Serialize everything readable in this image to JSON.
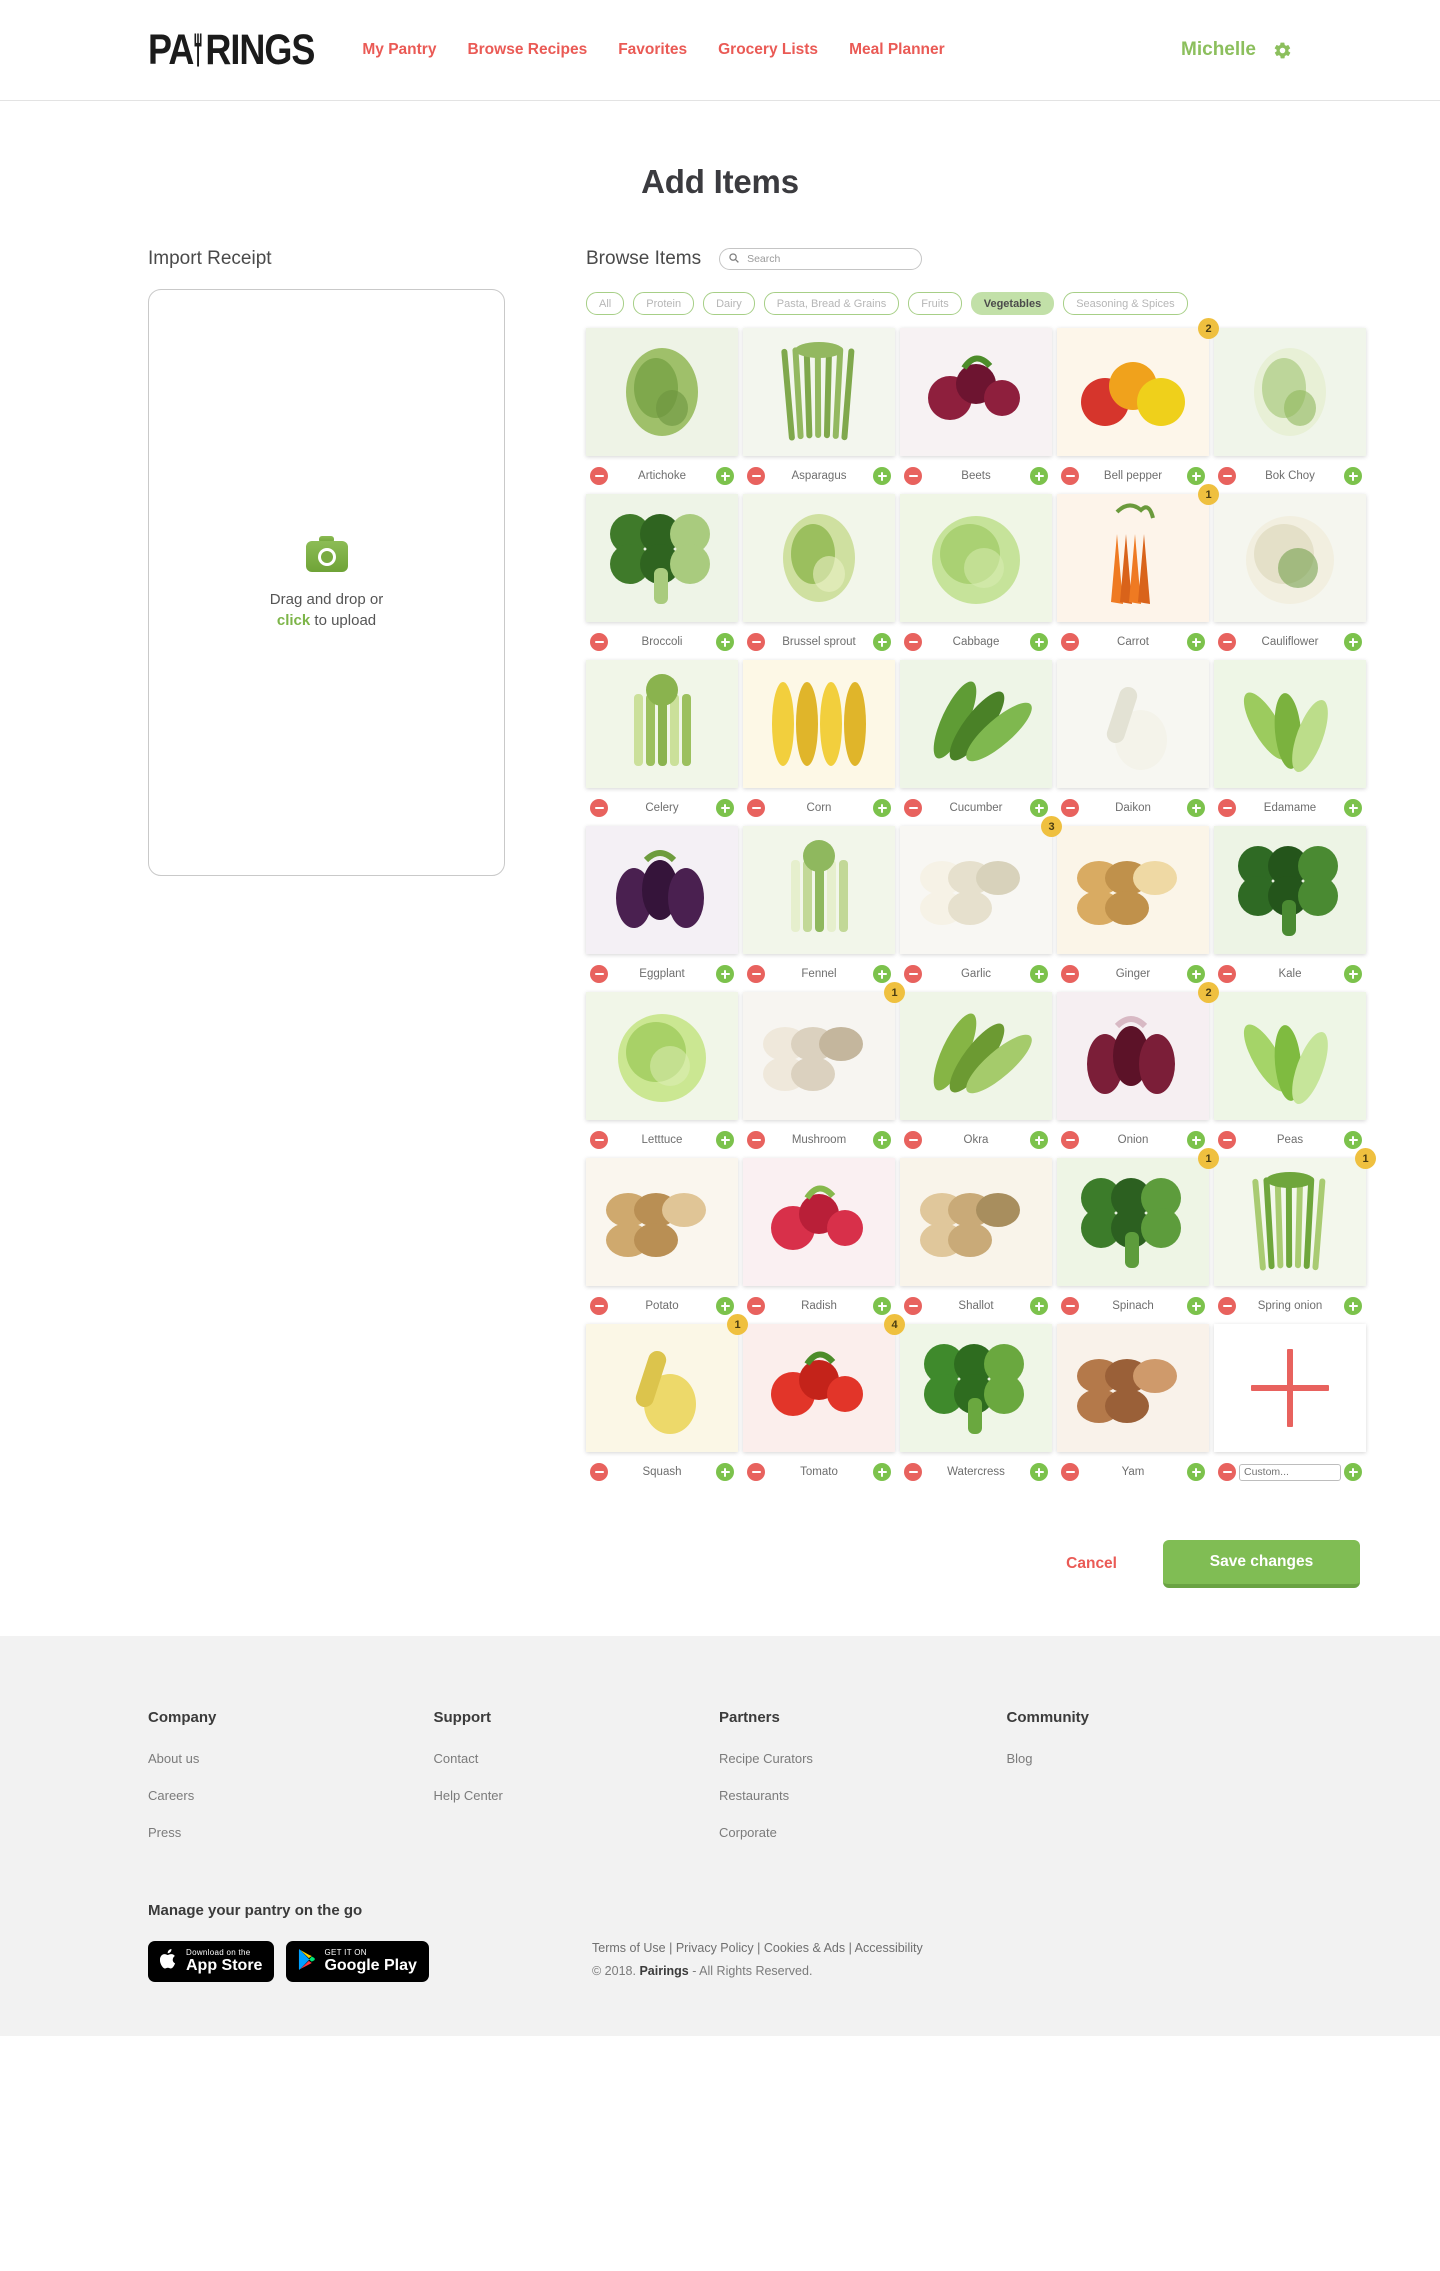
{
  "header": {
    "logo_text_a": "PA",
    "logo_text_b": "RINGS",
    "nav": [
      {
        "label": "My Pantry"
      },
      {
        "label": "Browse Recipes"
      },
      {
        "label": "Favorites"
      },
      {
        "label": "Grocery Lists"
      },
      {
        "label": "Meal Planner"
      }
    ],
    "user_name": "Michelle",
    "settings_icon": "gear-icon",
    "accent_red": "#ea5a55",
    "accent_green": "#8cbf5d"
  },
  "page_title": "Add Items",
  "import": {
    "title": "Import Receipt",
    "icon": "camera-icon",
    "line1": "Drag and drop or",
    "line2_link": "click",
    "line2_rest": " to upload"
  },
  "browse": {
    "title": "Browse Items",
    "search_placeholder": "Search",
    "search_value": "",
    "search_icon": "search-icon",
    "filters": [
      {
        "label": "All",
        "active": false
      },
      {
        "label": "Protein",
        "active": false
      },
      {
        "label": "Dairy",
        "active": false
      },
      {
        "label": "Pasta, Bread & Grains",
        "active": false
      },
      {
        "label": "Fruits",
        "active": false
      },
      {
        "label": "Vegetables",
        "active": true
      },
      {
        "label": "Seasoning & Spices",
        "active": false
      }
    ],
    "items": [
      {
        "name": "Artichoke",
        "badge": null,
        "img": "artichoke"
      },
      {
        "name": "Asparagus",
        "badge": null,
        "img": "asparagus"
      },
      {
        "name": "Beets",
        "badge": null,
        "img": "beets"
      },
      {
        "name": "Bell pepper",
        "badge": "2",
        "img": "bellpepper"
      },
      {
        "name": "Bok Choy",
        "badge": null,
        "img": "bokchoy"
      },
      {
        "name": "Broccoli",
        "badge": null,
        "img": "broccoli"
      },
      {
        "name": "Brussel sprout",
        "badge": null,
        "img": "brussel"
      },
      {
        "name": "Cabbage",
        "badge": null,
        "img": "cabbage"
      },
      {
        "name": "Carrot",
        "badge": "1",
        "img": "carrot"
      },
      {
        "name": "Cauliflower",
        "badge": null,
        "img": "cauliflower"
      },
      {
        "name": "Celery",
        "badge": null,
        "img": "celery"
      },
      {
        "name": "Corn",
        "badge": null,
        "img": "corn"
      },
      {
        "name": "Cucumber",
        "badge": null,
        "img": "cucumber"
      },
      {
        "name": "Daikon",
        "badge": null,
        "img": "daikon"
      },
      {
        "name": "Edamame",
        "badge": null,
        "img": "edamame"
      },
      {
        "name": "Eggplant",
        "badge": null,
        "img": "eggplant"
      },
      {
        "name": "Fennel",
        "badge": null,
        "img": "fennel"
      },
      {
        "name": "Garlic",
        "badge": "3",
        "img": "garlic"
      },
      {
        "name": "Ginger",
        "badge": null,
        "img": "ginger"
      },
      {
        "name": "Kale",
        "badge": null,
        "img": "kale"
      },
      {
        "name": "Letttuce",
        "badge": null,
        "img": "lettuce"
      },
      {
        "name": "Mushroom",
        "badge": "1",
        "img": "mushroom"
      },
      {
        "name": "Okra",
        "badge": null,
        "img": "okra"
      },
      {
        "name": "Onion",
        "badge": "2",
        "img": "onion"
      },
      {
        "name": "Peas",
        "badge": null,
        "img": "peas"
      },
      {
        "name": "Potato",
        "badge": null,
        "img": "potato"
      },
      {
        "name": "Radish",
        "badge": null,
        "img": "radish"
      },
      {
        "name": "Shallot",
        "badge": null,
        "img": "shallot"
      },
      {
        "name": "Spinach",
        "badge": "1",
        "img": "spinach"
      },
      {
        "name": "Spring onion",
        "badge": "1",
        "img": "springonion"
      },
      {
        "name": "Squash",
        "badge": "1",
        "img": "squash"
      },
      {
        "name": "Tomato",
        "badge": "4",
        "img": "tomato"
      },
      {
        "name": "Watercress",
        "badge": null,
        "img": "watercress"
      },
      {
        "name": "Yam",
        "badge": null,
        "img": "yam"
      }
    ],
    "custom": {
      "placeholder": "Custom...",
      "value": "",
      "badge": null
    },
    "badge_color": "#efc03f",
    "minus_color": "#e8625e",
    "plus_color": "#7cc24c"
  },
  "actions": {
    "cancel": "Cancel",
    "save": "Save changes"
  },
  "footer": {
    "columns": [
      {
        "heading": "Company",
        "links": [
          "About us",
          "Careers",
          "Press"
        ]
      },
      {
        "heading": "Support",
        "links": [
          "Contact",
          "Help Center"
        ]
      },
      {
        "heading": "Partners",
        "links": [
          "Recipe Curators",
          "Restaurants",
          "Corporate"
        ]
      },
      {
        "heading": "Community",
        "links": [
          "Blog"
        ]
      }
    ],
    "promo_title": "Manage your pantry on the go",
    "stores": [
      {
        "sub": "Download on the",
        "main": "App Store",
        "icon": "apple-icon"
      },
      {
        "sub": "GET IT ON",
        "main": "Google Play",
        "icon": "google-play-icon"
      }
    ],
    "legal_links": [
      "Terms of Use",
      "Privacy Policy",
      "Cookies & Ads",
      "Accessibility"
    ],
    "copyright_pre": "© 2018. ",
    "copyright_brand": "Pairings",
    "copyright_post": " - All Rights Reserved."
  }
}
